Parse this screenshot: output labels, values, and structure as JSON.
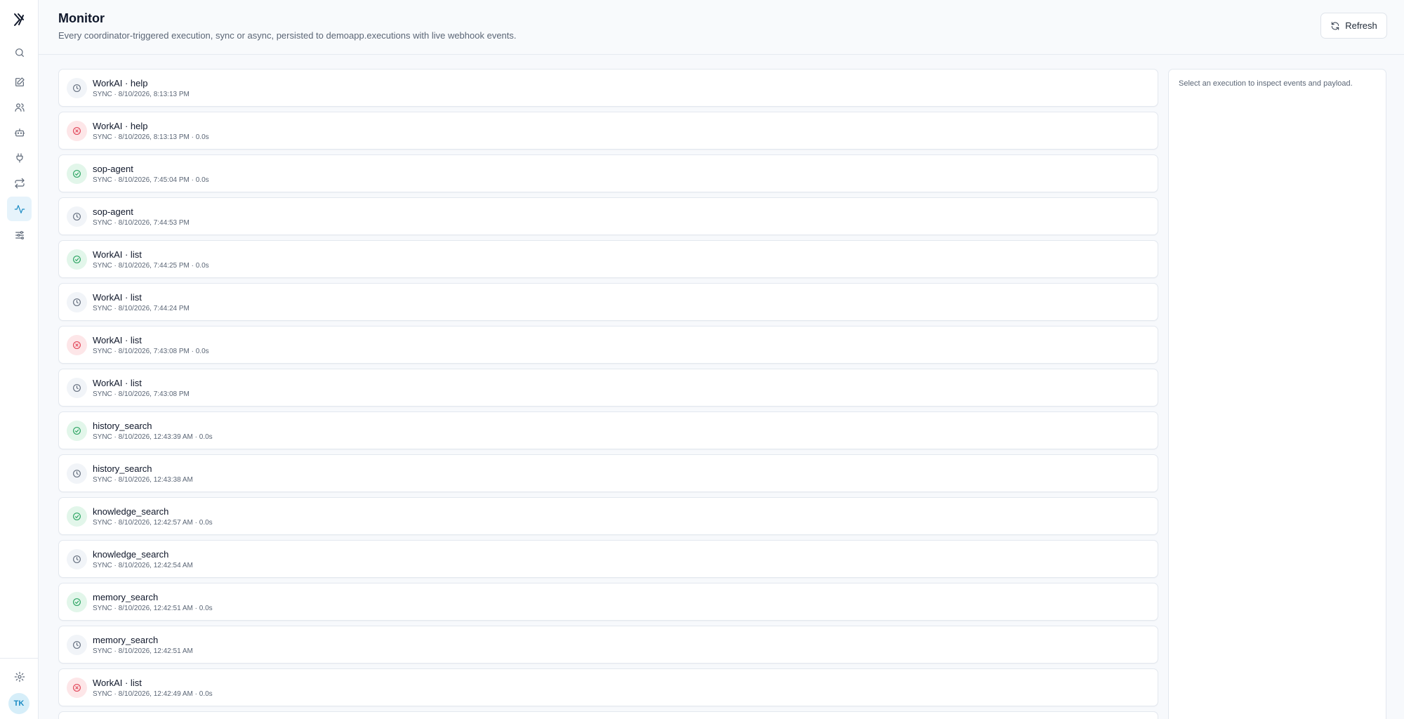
{
  "sidebar": {
    "logo_icon": "brand-logo-icon",
    "items": [
      {
        "icon": "search-icon"
      },
      {
        "icon": "edit-icon"
      },
      {
        "icon": "users-icon"
      },
      {
        "icon": "bot-icon"
      },
      {
        "icon": "plug-icon"
      },
      {
        "icon": "repeat-icon"
      },
      {
        "icon": "activity-icon",
        "active": true
      },
      {
        "icon": "sliders-icon"
      }
    ],
    "settings_icon": "gear-icon",
    "avatar_initials": "TK"
  },
  "header": {
    "title": "Monitor",
    "subtitle": "Every coordinator-triggered execution, sync or async, persisted to demoapp.executions with live webhook events.",
    "refresh_label": "Refresh"
  },
  "executions": [
    {
      "name": "WorkAI · help",
      "meta": "SYNC · 8/10/2026, 8:13:13 PM",
      "status": "pending"
    },
    {
      "name": "WorkAI · help",
      "meta": "SYNC · 8/10/2026, 8:13:13 PM · 0.0s",
      "status": "error"
    },
    {
      "name": "sop-agent",
      "meta": "SYNC · 8/10/2026, 7:45:04 PM · 0.0s",
      "status": "success"
    },
    {
      "name": "sop-agent",
      "meta": "SYNC · 8/10/2026, 7:44:53 PM",
      "status": "pending"
    },
    {
      "name": "WorkAI · list",
      "meta": "SYNC · 8/10/2026, 7:44:25 PM · 0.0s",
      "status": "success"
    },
    {
      "name": "WorkAI · list",
      "meta": "SYNC · 8/10/2026, 7:44:24 PM",
      "status": "pending"
    },
    {
      "name": "WorkAI · list",
      "meta": "SYNC · 8/10/2026, 7:43:08 PM · 0.0s",
      "status": "error"
    },
    {
      "name": "WorkAI · list",
      "meta": "SYNC · 8/10/2026, 7:43:08 PM",
      "status": "pending"
    },
    {
      "name": "history_search",
      "meta": "SYNC · 8/10/2026, 12:43:39 AM · 0.0s",
      "status": "success"
    },
    {
      "name": "history_search",
      "meta": "SYNC · 8/10/2026, 12:43:38 AM",
      "status": "pending"
    },
    {
      "name": "knowledge_search",
      "meta": "SYNC · 8/10/2026, 12:42:57 AM · 0.0s",
      "status": "success"
    },
    {
      "name": "knowledge_search",
      "meta": "SYNC · 8/10/2026, 12:42:54 AM",
      "status": "pending"
    },
    {
      "name": "memory_search",
      "meta": "SYNC · 8/10/2026, 12:42:51 AM · 0.0s",
      "status": "success"
    },
    {
      "name": "memory_search",
      "meta": "SYNC · 8/10/2026, 12:42:51 AM",
      "status": "pending"
    },
    {
      "name": "WorkAI · list",
      "meta": "SYNC · 8/10/2026, 12:42:49 AM · 0.0s",
      "status": "error"
    },
    {
      "name": "",
      "meta": "",
      "status": "pending"
    }
  ],
  "detail": {
    "placeholder": "Select an execution to inspect events and payload."
  },
  "colors": {
    "accent": "#1a8bc4",
    "success": "#22a05b",
    "error": "#e03a4e",
    "pending": "#5b6676"
  }
}
